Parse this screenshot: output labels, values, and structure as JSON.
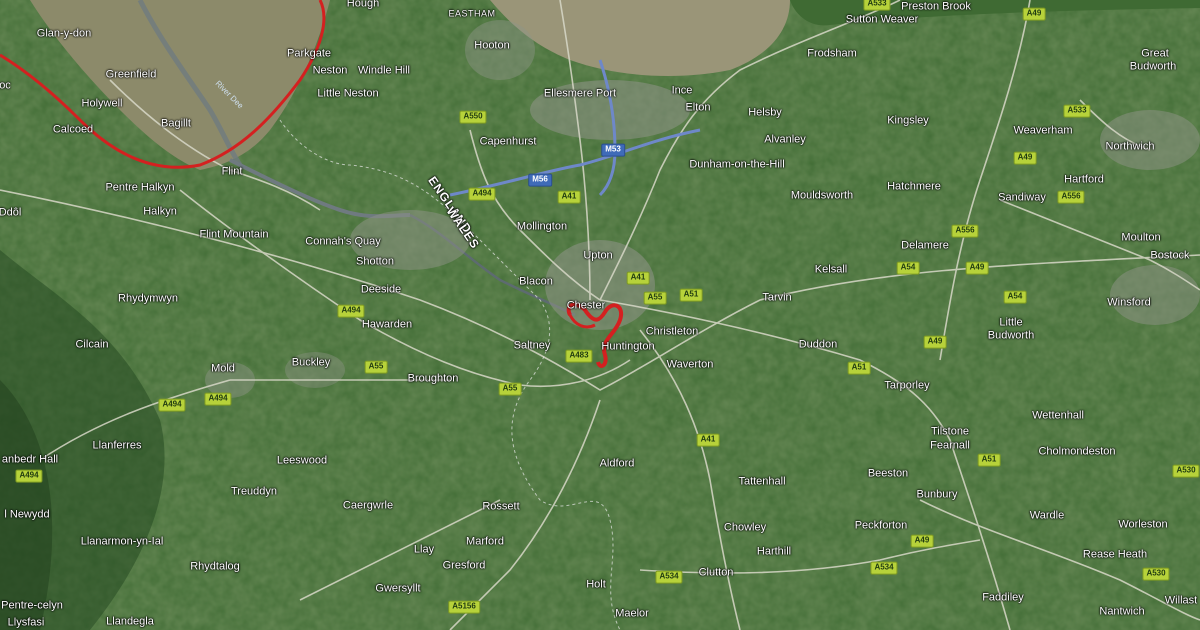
{
  "places": [
    {
      "name": "Hough"
    },
    {
      "name": "EASTHAM"
    },
    {
      "name": "Sutton Weaver"
    },
    {
      "name": "Preston Brook"
    },
    {
      "name": "Glan-y-don"
    },
    {
      "name": "Parkgate"
    },
    {
      "name": "Neston"
    },
    {
      "name": "Windle Hill"
    },
    {
      "name": "Hooton"
    },
    {
      "name": "Frodsham"
    },
    {
      "name": "Great"
    },
    {
      "name": "Budworth"
    },
    {
      "name": "Greenfield"
    },
    {
      "name": "oc"
    },
    {
      "name": "Holywell"
    },
    {
      "name": "Little Neston"
    },
    {
      "name": "Ellesmere Port"
    },
    {
      "name": "Ince"
    },
    {
      "name": "Elton"
    },
    {
      "name": "Helsby"
    },
    {
      "name": "Bagillt"
    },
    {
      "name": "Calcoed"
    },
    {
      "name": "Kingsley"
    },
    {
      "name": "Weaverham"
    },
    {
      "name": "Capenhurst"
    },
    {
      "name": "Alvanley"
    },
    {
      "name": "Flint"
    },
    {
      "name": "Northwich"
    },
    {
      "name": "Dunham-on-the-Hill"
    },
    {
      "name": "Pentre Halkyn"
    },
    {
      "name": "Hatchmere"
    },
    {
      "name": "Hartford"
    },
    {
      "name": "Mouldsworth"
    },
    {
      "name": "Sandiway"
    },
    {
      "name": "Halkyn"
    },
    {
      "name": "Ddôl"
    },
    {
      "name": "Mollington"
    },
    {
      "name": "Flint Mountain"
    },
    {
      "name": "Connah's Quay"
    },
    {
      "name": "Moulton"
    },
    {
      "name": "Delamere"
    },
    {
      "name": "Upton"
    },
    {
      "name": "Shotton"
    },
    {
      "name": "Bostock"
    },
    {
      "name": "Kelsall"
    },
    {
      "name": "Blacon"
    },
    {
      "name": "Deeside"
    },
    {
      "name": "Rhydymwyn"
    },
    {
      "name": "Tarvin"
    },
    {
      "name": "Winsford"
    },
    {
      "name": "Chester"
    },
    {
      "name": "Hawarden"
    },
    {
      "name": "Little"
    },
    {
      "name": "Budworth"
    },
    {
      "name": "Christleton"
    },
    {
      "name": "Cilcain"
    },
    {
      "name": "Saltney"
    },
    {
      "name": "Huntington"
    },
    {
      "name": "Duddon"
    },
    {
      "name": "Buckley"
    },
    {
      "name": "Waverton"
    },
    {
      "name": "Mold"
    },
    {
      "name": "Broughton"
    },
    {
      "name": "Tarporley"
    },
    {
      "name": "Wettenhall"
    },
    {
      "name": "Llanferres"
    },
    {
      "name": "Tilstone"
    },
    {
      "name": "Fearnall"
    },
    {
      "name": "Cholmondeston"
    },
    {
      "name": "anbedr Hall"
    },
    {
      "name": "Leeswood"
    },
    {
      "name": "Aldford"
    },
    {
      "name": "Beeston"
    },
    {
      "name": "Tattenhall"
    },
    {
      "name": "Treuddyn"
    },
    {
      "name": "Bunbury"
    },
    {
      "name": "Caergwrle"
    },
    {
      "name": "Rossett"
    },
    {
      "name": "Wardle"
    },
    {
      "name": "l Newydd"
    },
    {
      "name": "Worleston"
    },
    {
      "name": "Chowley"
    },
    {
      "name": "Peckforton"
    },
    {
      "name": "Llanarmon-yn-Ial"
    },
    {
      "name": "Marford"
    },
    {
      "name": "Harthill"
    },
    {
      "name": "Llay"
    },
    {
      "name": "Rease Heath"
    },
    {
      "name": "Rhydtalog"
    },
    {
      "name": "Gresford"
    },
    {
      "name": "Clutton"
    },
    {
      "name": "Holt"
    },
    {
      "name": "Gwersyllt"
    },
    {
      "name": "Faddiley"
    },
    {
      "name": "Pentre-celyn"
    },
    {
      "name": "Nantwich"
    },
    {
      "name": "Willast"
    },
    {
      "name": "Llysfasi"
    },
    {
      "name": "Llandegla"
    },
    {
      "name": "Maelor"
    }
  ],
  "border": {
    "line1": "ENGLAND",
    "line2": "WALES"
  },
  "river": "River Dee",
  "roads": [
    {
      "ref": "A533",
      "kind": "a"
    },
    {
      "ref": "A49",
      "kind": "a"
    },
    {
      "ref": "A533",
      "kind": "a"
    },
    {
      "ref": "A550",
      "kind": "a"
    },
    {
      "ref": "M53",
      "kind": "m"
    },
    {
      "ref": "A49",
      "kind": "a"
    },
    {
      "ref": "A494",
      "kind": "a"
    },
    {
      "ref": "M56",
      "kind": "m"
    },
    {
      "ref": "A41",
      "kind": "a"
    },
    {
      "ref": "A556",
      "kind": "a"
    },
    {
      "ref": "A556",
      "kind": "a"
    },
    {
      "ref": "A41",
      "kind": "a"
    },
    {
      "ref": "A55",
      "kind": "a"
    },
    {
      "ref": "A51",
      "kind": "a"
    },
    {
      "ref": "A54",
      "kind": "a"
    },
    {
      "ref": "A49",
      "kind": "a"
    },
    {
      "ref": "A54",
      "kind": "a"
    },
    {
      "ref": "A494",
      "kind": "a"
    },
    {
      "ref": "A483",
      "kind": "a"
    },
    {
      "ref": "A49",
      "kind": "a"
    },
    {
      "ref": "A51",
      "kind": "a"
    },
    {
      "ref": "A55",
      "kind": "a"
    },
    {
      "ref": "A55",
      "kind": "a"
    },
    {
      "ref": "A494",
      "kind": "a"
    },
    {
      "ref": "A494",
      "kind": "a"
    },
    {
      "ref": "A41",
      "kind": "a"
    },
    {
      "ref": "A51",
      "kind": "a"
    },
    {
      "ref": "A494",
      "kind": "a"
    },
    {
      "ref": "A49",
      "kind": "a"
    },
    {
      "ref": "A534",
      "kind": "a"
    },
    {
      "ref": "A534",
      "kind": "a"
    },
    {
      "ref": "A530",
      "kind": "a"
    },
    {
      "ref": "A5156",
      "kind": "a"
    },
    {
      "ref": "A530",
      "kind": "a"
    }
  ],
  "colors": {
    "land": "#3a6630",
    "estuary": "#8c8a6a",
    "route": "#d42020",
    "road": "#d8d8c8",
    "motorway": "#6e88c9"
  }
}
